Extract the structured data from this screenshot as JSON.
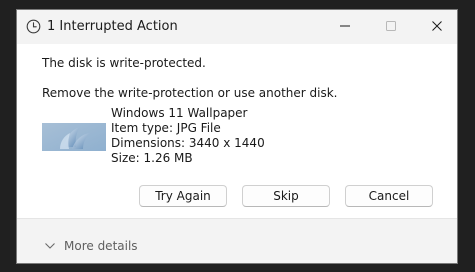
{
  "dialog": {
    "title": "1 Interrupted Action",
    "icons": {
      "title": "clock-icon",
      "minimize": "minimize-icon",
      "maximize": "maximize-icon",
      "close": "close-icon"
    }
  },
  "content": {
    "message_primary": "The disk is write-protected.",
    "message_secondary": "Remove the write-protection or use another disk.",
    "file": {
      "name": "Windows 11 Wallpaper",
      "type": "Item type: JPG File",
      "dimensions": "Dimensions: 3440 x 1440",
      "size": "Size: 1.26 MB"
    }
  },
  "buttons": {
    "try_again": "Try Again",
    "skip": "Skip",
    "cancel": "Cancel"
  },
  "footer": {
    "more_details": "More details",
    "icon": "chevron-down-icon"
  }
}
